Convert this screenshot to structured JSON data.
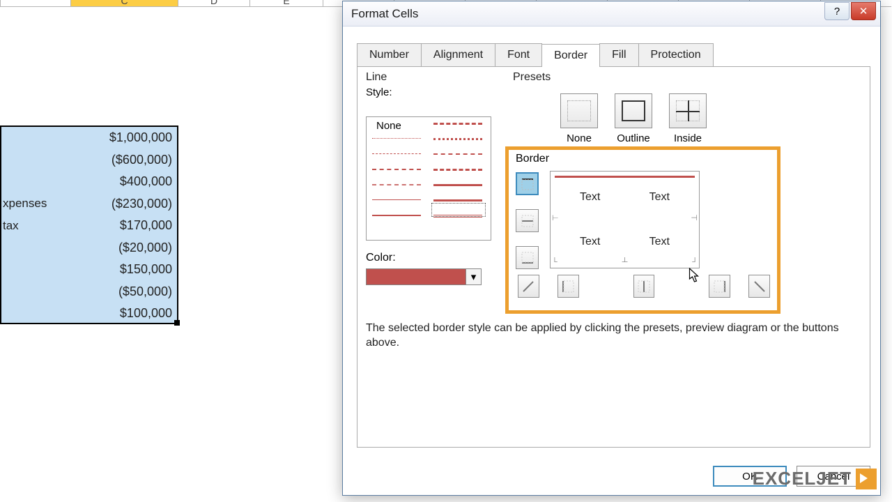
{
  "columns": [
    "",
    "C",
    "D",
    "E"
  ],
  "selected_column_index": 1,
  "spreadsheet": {
    "rows": [
      {
        "label": "",
        "value": "$1,000,000"
      },
      {
        "label": "",
        "value": "($600,000)"
      },
      {
        "label": "",
        "value": "$400,000"
      },
      {
        "label": "xpenses",
        "value": "($230,000)"
      },
      {
        "label": " tax",
        "value": "$170,000"
      },
      {
        "label": "",
        "value": "($20,000)"
      },
      {
        "label": "",
        "value": "$150,000"
      },
      {
        "label": "",
        "value": "($50,000)"
      },
      {
        "label": "",
        "value": "$100,000"
      }
    ]
  },
  "dialog": {
    "title": "Format Cells",
    "tabs": [
      "Number",
      "Alignment",
      "Font",
      "Border",
      "Fill",
      "Protection"
    ],
    "active_tab": "Border",
    "line_group": "Line",
    "style_label": "Style:",
    "style_none": "None",
    "color_label": "Color:",
    "selected_color": "#c0504d",
    "presets_group": "Presets",
    "presets": [
      "None",
      "Outline",
      "Inside"
    ],
    "border_group": "Border",
    "preview_text": {
      "tl": "Text",
      "tr": "Text",
      "bl": "Text",
      "br": "Text"
    },
    "help_text": "The selected border style can be applied by clicking the presets, preview diagram or the buttons above.",
    "ok": "OK",
    "cancel": "Cancel"
  },
  "watermark": "EXCELJET"
}
